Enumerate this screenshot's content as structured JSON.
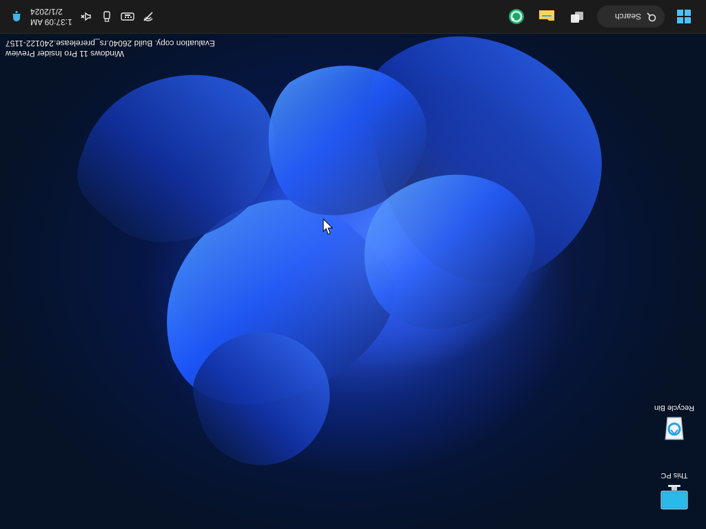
{
  "wallpaper": {
    "name": "Windows 11 Bloom (blue)"
  },
  "taskbar": {
    "start_icon": "windows-logo-icon",
    "search": {
      "label": "Search",
      "icon": "search-icon"
    },
    "pinned": [
      {
        "name": "task-view-icon"
      },
      {
        "name": "file-explorer-icon"
      },
      {
        "name": "app-icon-green-ring"
      }
    ],
    "tray": {
      "icons": [
        "network-off-icon",
        "keyboard-icon",
        "usb-device-icon",
        "speaker-muted-icon"
      ],
      "time": "1:37:09 AM",
      "date": "2/1/2024",
      "notifications_icon": "bell-icon"
    }
  },
  "watermark": {
    "line1": "Windows 11 Pro Insider Preview",
    "line2": "Evaluation copy. Build 26040.rs_prerelease.240122-1157"
  },
  "desktop": {
    "icons": [
      {
        "label": "This PC",
        "icon": "monitor-icon"
      },
      {
        "label": "Recycle Bin",
        "icon": "recycle-bin-icon"
      }
    ]
  },
  "colors": {
    "taskbar_bg": "#1b1b1b",
    "accent": "#2f6bff",
    "text": "#ffffff"
  },
  "screen": {
    "orientation": "rotated 180 degrees"
  }
}
